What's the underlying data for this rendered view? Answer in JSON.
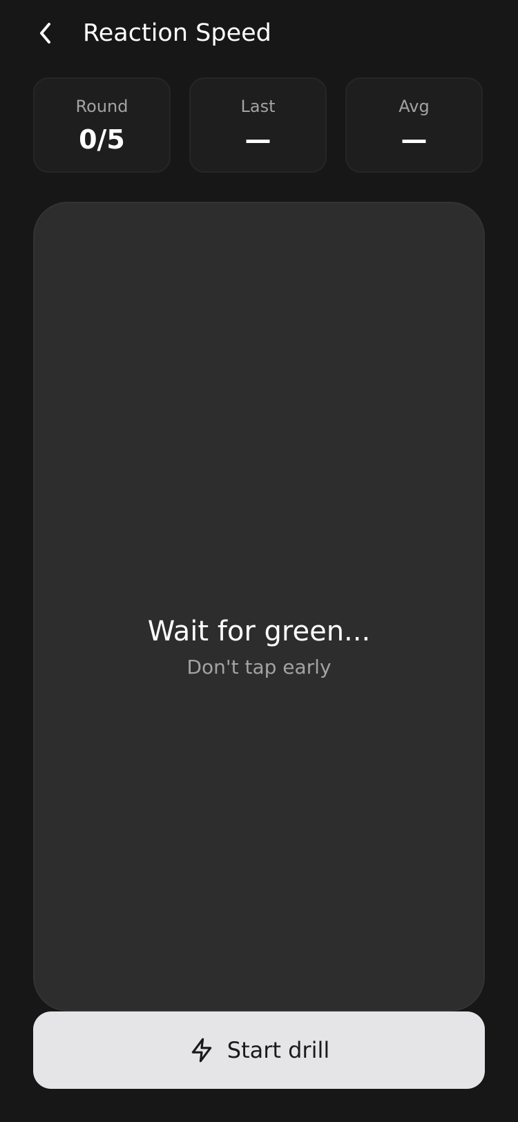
{
  "header": {
    "title": "Reaction Speed",
    "back_icon": "chevron-left-icon"
  },
  "stats": [
    {
      "label": "Round",
      "value": "0/5"
    },
    {
      "label": "Last",
      "value": "—"
    },
    {
      "label": "Avg",
      "value": "—"
    }
  ],
  "play_area": {
    "prompt": "Wait for green...",
    "hint": "Don't tap early"
  },
  "start_button": {
    "label": "Start drill",
    "icon": "lightning-bolt-icon"
  },
  "colors": {
    "background": "#171717",
    "card": "#1e1e1e",
    "play_area": "#2d2d2d",
    "button": "#e5e5e7"
  }
}
